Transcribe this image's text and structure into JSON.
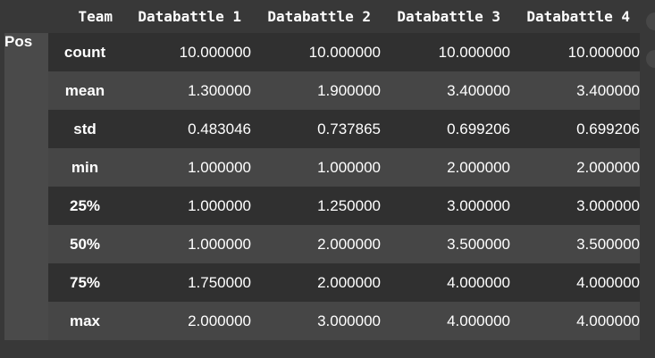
{
  "table": {
    "column_header_label": "Team",
    "columns": [
      "Databattle 1",
      "Databattle 2",
      "Databattle 3",
      "Databattle 4"
    ],
    "row_index_name": "Pos",
    "rows": [
      {
        "stat": "count",
        "values": [
          "10.000000",
          "10.000000",
          "10.000000",
          "10.000000"
        ]
      },
      {
        "stat": "mean",
        "values": [
          "1.300000",
          "1.900000",
          "3.400000",
          "3.400000"
        ]
      },
      {
        "stat": "std",
        "values": [
          "0.483046",
          "0.737865",
          "0.699206",
          "0.699206"
        ]
      },
      {
        "stat": "min",
        "values": [
          "1.000000",
          "1.000000",
          "2.000000",
          "2.000000"
        ]
      },
      {
        "stat": "25%",
        "values": [
          "1.000000",
          "1.250000",
          "3.000000",
          "3.000000"
        ]
      },
      {
        "stat": "50%",
        "values": [
          "1.000000",
          "2.000000",
          "3.500000",
          "3.500000"
        ]
      },
      {
        "stat": "75%",
        "values": [
          "1.750000",
          "2.000000",
          "4.000000",
          "4.000000"
        ]
      },
      {
        "stat": "max",
        "values": [
          "2.000000",
          "3.000000",
          "4.000000",
          "4.000000"
        ]
      }
    ]
  },
  "colors": {
    "background": "#383838",
    "row_odd": "#303030",
    "row_even": "#464646",
    "text": "#ffffff"
  }
}
